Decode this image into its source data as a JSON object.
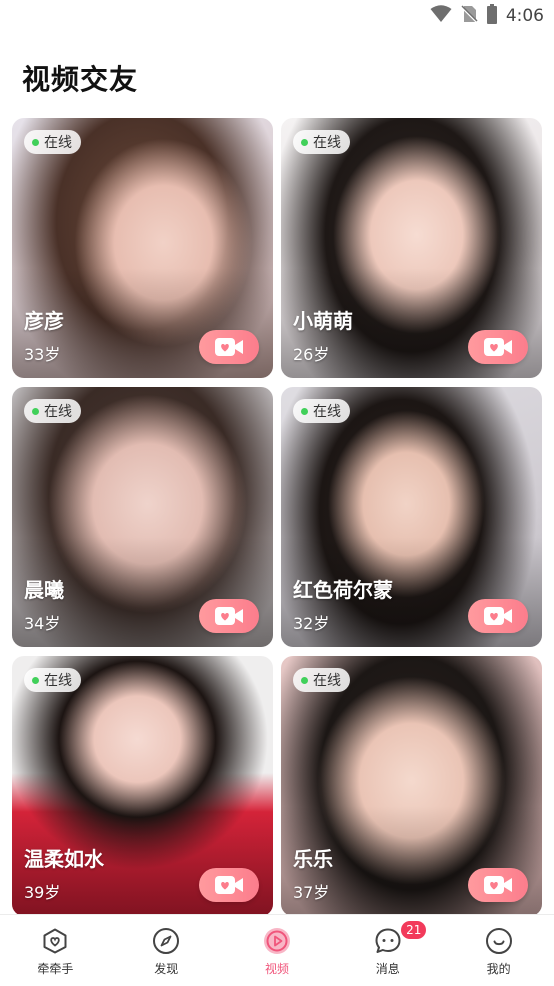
{
  "status_bar": {
    "time": "4:06"
  },
  "page": {
    "title": "视频交友"
  },
  "colors": {
    "accent": "#f0557b",
    "online": "#41d05a",
    "badge": "#f23a5b"
  },
  "cards": [
    {
      "status": "在线",
      "name": "彦彦",
      "age": "33岁"
    },
    {
      "status": "在线",
      "name": "小萌萌",
      "age": "26岁"
    },
    {
      "status": "在线",
      "name": "晨曦",
      "age": "34岁"
    },
    {
      "status": "在线",
      "name": "红色荷尔蒙",
      "age": "32岁"
    },
    {
      "status": "在线",
      "name": "温柔如水",
      "age": "39岁"
    },
    {
      "status": "在线",
      "name": "乐乐",
      "age": "37岁"
    }
  ],
  "nav": {
    "items": [
      {
        "label": "牵牵手",
        "icon": "heart-home-icon"
      },
      {
        "label": "发现",
        "icon": "compass-icon"
      },
      {
        "label": "视频",
        "icon": "play-icon"
      },
      {
        "label": "消息",
        "icon": "chat-icon",
        "badge": "21"
      },
      {
        "label": "我的",
        "icon": "smile-icon"
      }
    ]
  }
}
